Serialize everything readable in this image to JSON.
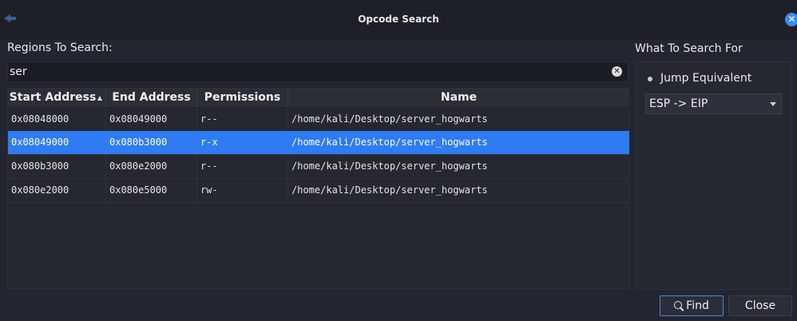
{
  "window": {
    "title": "Opcode Search",
    "close_glyph": "✕"
  },
  "regions": {
    "label": "Regions To Search:",
    "filter_value": "ser",
    "clear_glyph": "✕",
    "columns": {
      "start": "Start Address",
      "end": "End Address",
      "perms": "Permissions",
      "name": "Name"
    },
    "sort_glyph": "▲",
    "rows": [
      {
        "start": "0x08048000",
        "end": "0x08049000",
        "perms": "r--",
        "name": "/home/kali/Desktop/server_hogwarts"
      },
      {
        "start": "0x08049000",
        "end": "0x080b3000",
        "perms": "r-x",
        "name": "/home/kali/Desktop/server_hogwarts"
      },
      {
        "start": "0x080b3000",
        "end": "0x080e2000",
        "perms": "r--",
        "name": "/home/kali/Desktop/server_hogwarts"
      },
      {
        "start": "0x080e2000",
        "end": "0x080e5000",
        "perms": "rw-",
        "name": "/home/kali/Desktop/server_hogwarts"
      }
    ]
  },
  "search_for": {
    "label": "What To Search For",
    "radio_prefix": "J",
    "radio_rest": "ump Equivalent",
    "dropdown_value": "ESP -> EIP"
  },
  "buttons": {
    "find": "Find",
    "close": "Close"
  },
  "colors": {
    "selection": "#2f7bf3",
    "accent": "#3b8df0"
  }
}
